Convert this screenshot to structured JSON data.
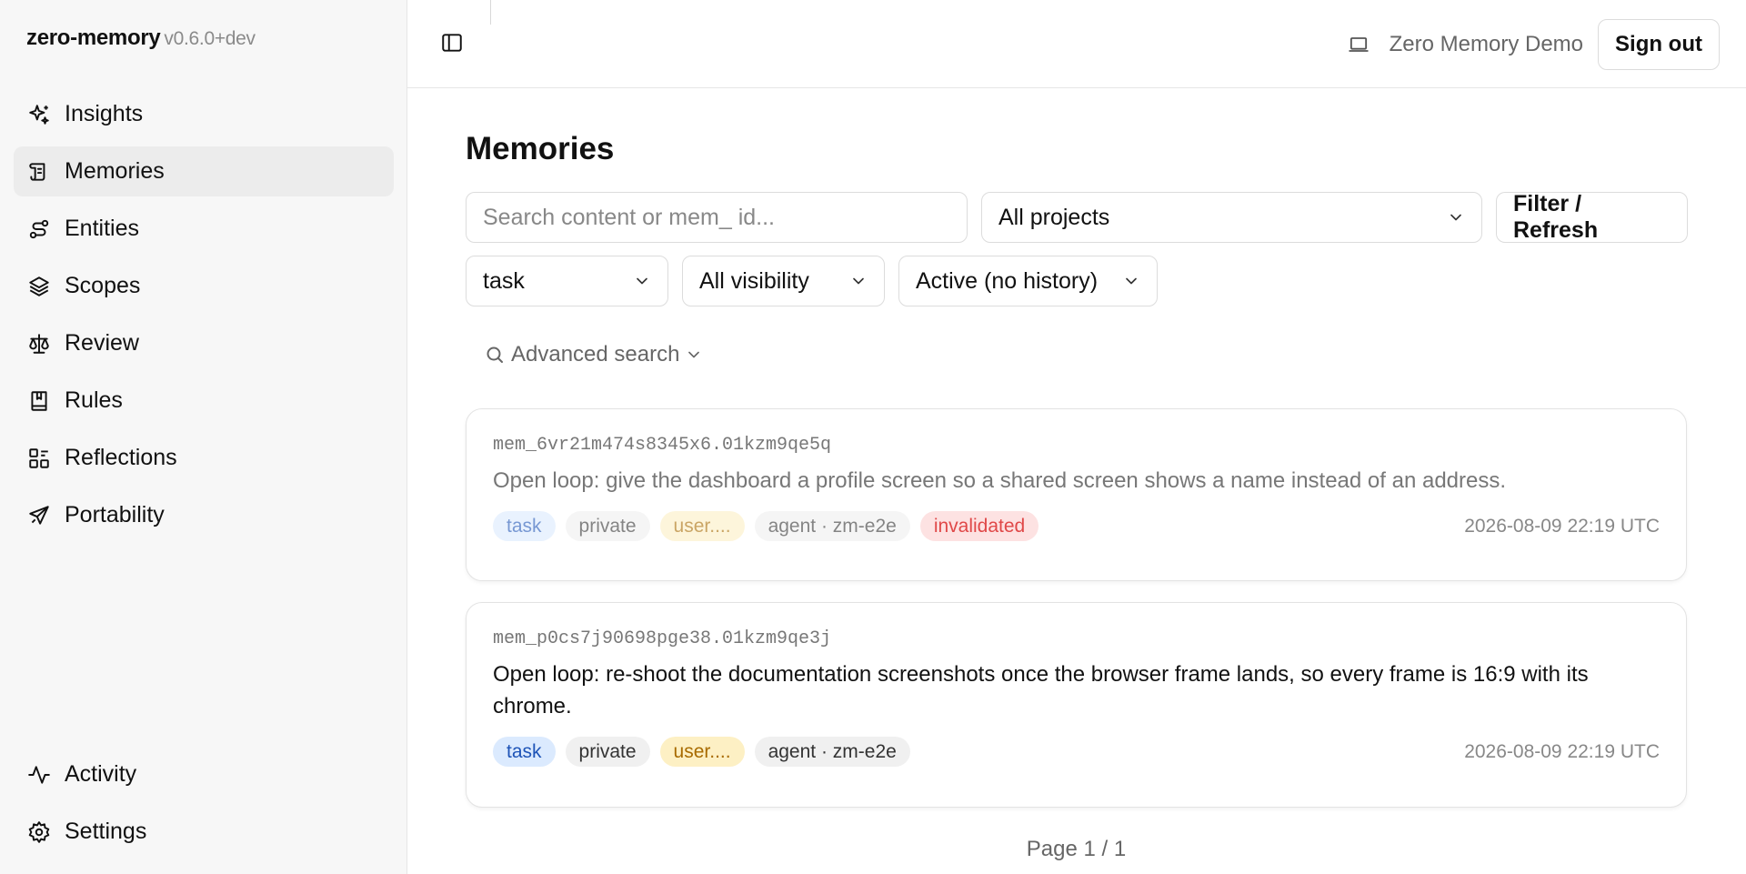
{
  "app": {
    "name": "zero-memory",
    "version": "v0.6.0+dev"
  },
  "sidebar": {
    "items": [
      {
        "label": "Insights",
        "icon": "sparkles-icon"
      },
      {
        "label": "Memories",
        "icon": "scroll-icon",
        "active": true
      },
      {
        "label": "Entities",
        "icon": "route-icon"
      },
      {
        "label": "Scopes",
        "icon": "layers-icon"
      },
      {
        "label": "Review",
        "icon": "scale-icon"
      },
      {
        "label": "Rules",
        "icon": "book-icon"
      },
      {
        "label": "Reflections",
        "icon": "shapes-icon"
      },
      {
        "label": "Portability",
        "icon": "plane-icon"
      }
    ],
    "bottom_items": [
      {
        "label": "Activity",
        "icon": "activity-icon"
      },
      {
        "label": "Settings",
        "icon": "gear-icon"
      }
    ]
  },
  "header": {
    "account_name": "Zero Memory Demo",
    "sign_out_label": "Sign out"
  },
  "main": {
    "title": "Memories",
    "search": {
      "placeholder": "Search content or mem_ id...",
      "value": ""
    },
    "project_filter": "All projects",
    "filter_button": "Filter / Refresh",
    "type_filter": "task",
    "visibility_filter": "All visibility",
    "status_filter": "Active (no history)",
    "advanced_search_label": "Advanced search",
    "memories": [
      {
        "id": "mem_6vr21m474s8345x6.01kzm9qe5q",
        "content": "Open loop: give the dashboard a profile screen so a shared screen shows a name instead of an address.",
        "tags": [
          {
            "text": "task",
            "style": "blue"
          },
          {
            "text": "private",
            "style": "gray"
          },
          {
            "text": "user....",
            "style": "yellow"
          },
          {
            "text": "agent · zm-e2e",
            "style": "gray"
          },
          {
            "text": "invalidated",
            "style": "red"
          }
        ],
        "timestamp": "2026-08-09 22:19 UTC",
        "dimmed": true
      },
      {
        "id": "mem_p0cs7j90698pge38.01kzm9qe3j",
        "content": "Open loop: re-shoot the documentation screenshots once the browser frame lands, so every frame is 16:9 with its chrome.",
        "tags": [
          {
            "text": "task",
            "style": "blue"
          },
          {
            "text": "private",
            "style": "gray"
          },
          {
            "text": "user....",
            "style": "yellow"
          },
          {
            "text": "agent · zm-e2e",
            "style": "gray"
          }
        ],
        "timestamp": "2026-08-09 22:19 UTC",
        "dimmed": false
      }
    ],
    "pagination": "Page 1 / 1"
  }
}
